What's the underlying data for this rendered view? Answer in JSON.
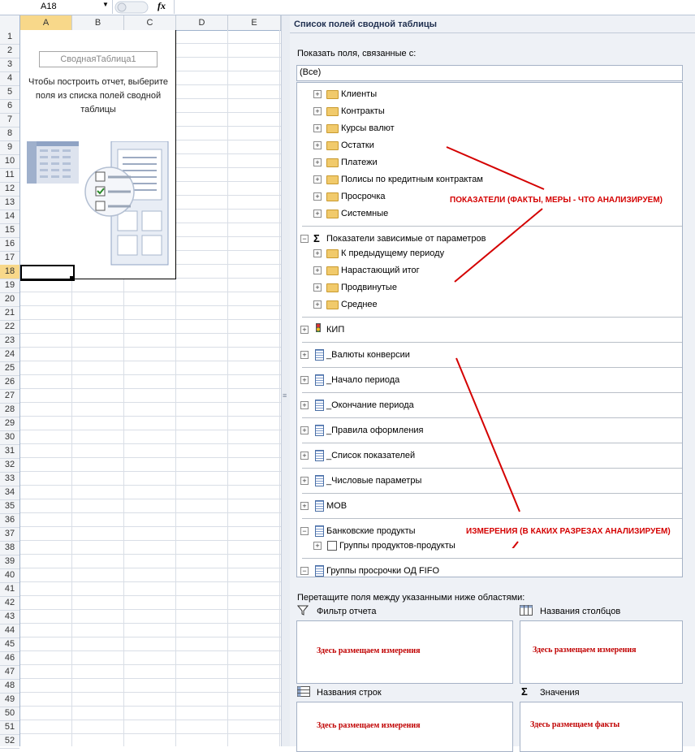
{
  "formula_bar": {
    "name_box": "A18",
    "fx_label": "fx",
    "formula": ""
  },
  "sheet": {
    "columns": [
      "A",
      "B",
      "C",
      "D",
      "E"
    ],
    "rows": [
      "1",
      "2",
      "3",
      "4",
      "5",
      "6",
      "7",
      "8",
      "9",
      "10",
      "11",
      "12",
      "13",
      "14",
      "15",
      "16",
      "17",
      "18",
      "19",
      "20",
      "21",
      "22",
      "23",
      "24",
      "25",
      "26",
      "27",
      "28",
      "29",
      "30",
      "31",
      "32",
      "33",
      "34",
      "35",
      "36",
      "37",
      "38",
      "39",
      "40",
      "41",
      "42",
      "43",
      "44",
      "45",
      "46",
      "47",
      "48",
      "49",
      "50",
      "51",
      "52"
    ],
    "selected_row": "18",
    "pivot_name": "СводнаяТаблица1",
    "pivot_hint": "Чтобы построить отчет, выберите поля из списка полей сводной таблицы"
  },
  "pane": {
    "title": "Список полей сводной таблицы",
    "show_label": "Показать поля, связанные с:",
    "show_value": "(Все)",
    "drag_label": "Перетащите поля между указанными ниже областями:",
    "areas": {
      "filter": {
        "label": "Фильтр отчета",
        "hint": "Здесь размещаем измерения"
      },
      "columns": {
        "label": "Названия столбцов",
        "hint": "Здесь размещаем измерения"
      },
      "rows": {
        "label": "Названия строк",
        "hint": "Здесь размещаем измерения"
      },
      "values": {
        "label": "Значения",
        "hint": "Здесь размещаем факты"
      }
    }
  },
  "tree": {
    "measure_folders": [
      "Клиенты",
      "Контракты",
      "Курсы валют",
      "Остатки",
      "Платежи",
      "Полисы по кредитным контрактам",
      "Просрочка",
      "Системные"
    ],
    "param_group": "Показатели зависимые от параметров",
    "param_folders": [
      "К предыдущему периоду",
      "Нарастающий итог",
      "Продвинутые",
      "Среднее"
    ],
    "kpi": "КИП",
    "dimensions": [
      "_Валюты конверсии",
      "_Начало периода",
      "_Окончание периода",
      "_Правила оформления",
      "_Список показателей",
      "_Числовые параметры",
      "МОВ"
    ],
    "bank_products": "Банковские продукты",
    "product_groups": "Группы продуктов-продукты",
    "overdue_groups": "Группы просрочки ОД FIFO"
  },
  "annotations": {
    "measures": "ПОКАЗАТЕЛИ (ФАКТЫ, МЕРЫ - ЧТО АНАЛИЗИРУЕМ)",
    "dimensions": "ИЗМЕРЕНИЯ (В КАКИХ РАЗРЕЗАХ АНАЛИЗИРУЕМ)",
    "color": "#d40000"
  }
}
